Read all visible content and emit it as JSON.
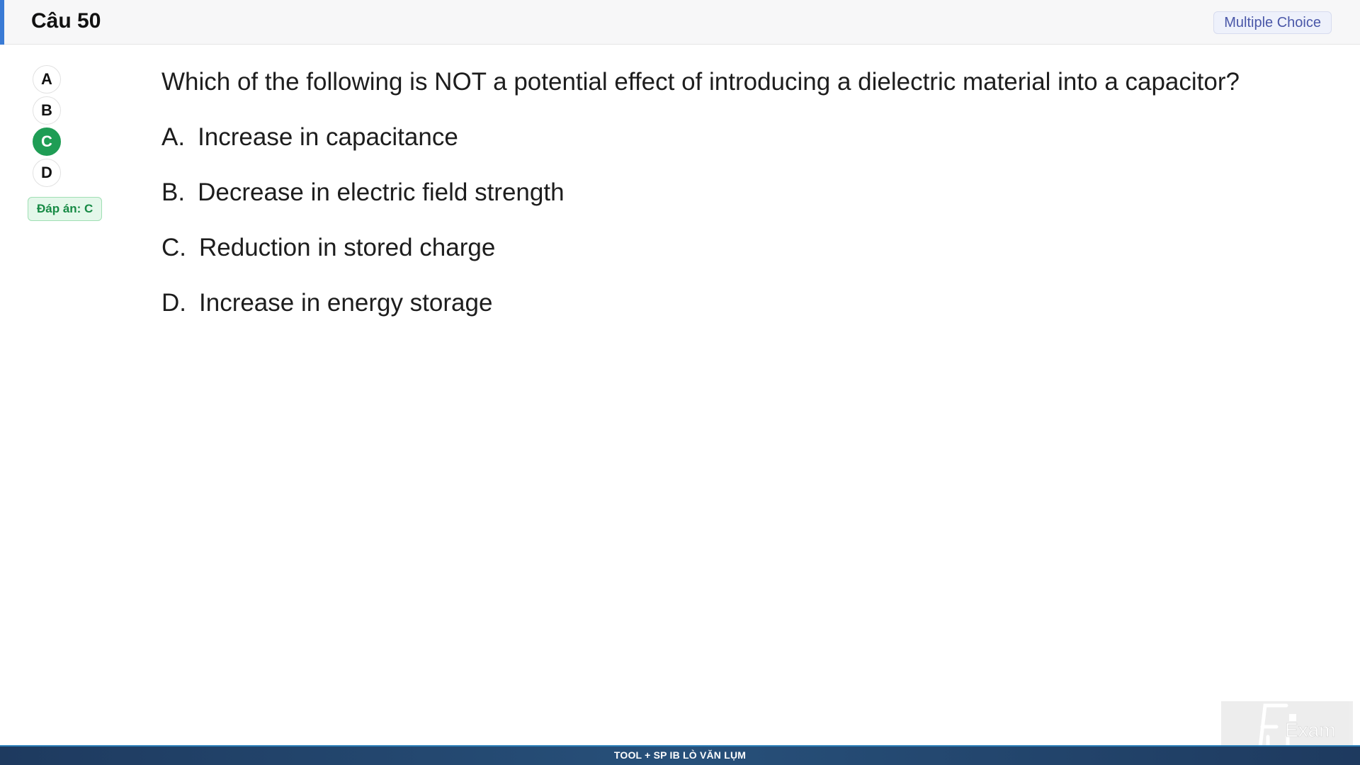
{
  "header": {
    "title": "Câu 50",
    "question_type": "Multiple Choice"
  },
  "answer_nav": {
    "choices": [
      "A",
      "B",
      "C",
      "D"
    ],
    "selected": "C",
    "answer_label": "Đáp án: C"
  },
  "question": {
    "text": "Which of the following is NOT a potential effect of introducing a dielectric material into a capacitor?",
    "options": [
      {
        "letter": "A.",
        "text": "Increase in capacitance"
      },
      {
        "letter": "B.",
        "text": "Decrease in electric field strength"
      },
      {
        "letter": "C.",
        "text": "Reduction in stored charge"
      },
      {
        "letter": "D.",
        "text": "Increase in energy storage"
      }
    ]
  },
  "footer": {
    "text": "TOOL + SP IB LÒ VĂN LỤM"
  },
  "logo": {
    "text": "Exam",
    "icon": "fu-exam-logo-icon"
  },
  "colors": {
    "accent": "#3a7bd5",
    "selected": "#1f9d55",
    "badge_text": "#4a57a8",
    "footer_bg": "#1e3a5f"
  }
}
